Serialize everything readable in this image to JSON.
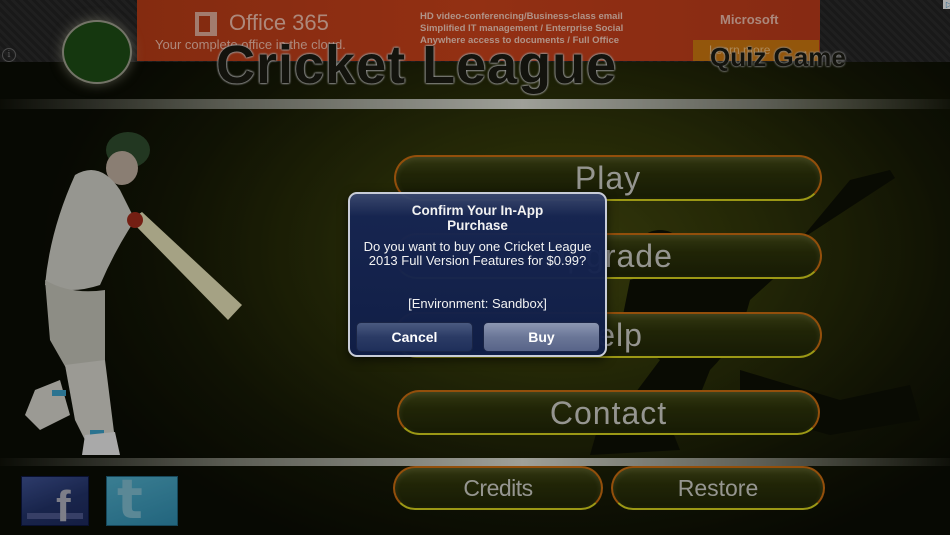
{
  "ad": {
    "brand": "Office 365",
    "tagline": "Your complete office in the cloud.",
    "features": [
      "HD video-conferencing/Business-class email",
      "Simplified IT management / Enterprise Social",
      "Anywhere access to documents / Full Office"
    ],
    "company": "Microsoft",
    "cta_label": "Learn more",
    "cta_arrow": "→",
    "info_glyph": "i",
    "adchoices_glyph": "▷",
    "colors": {
      "banner": "#c4401a",
      "cta": "#c5730f"
    }
  },
  "header": {
    "title": "Cricket League",
    "subtitle": "Quiz Game"
  },
  "menu": {
    "play": "Play",
    "upgrade": "Upgrade",
    "help": "Help",
    "contact": "Contact",
    "credits": "Credits",
    "restore": "Restore"
  },
  "social": {
    "facebook_glyph": "f",
    "twitter_glyph": "t"
  },
  "dialog": {
    "title": "Confirm Your In-App Purchase",
    "message": "Do you want to buy one Cricket League 2013 Full Version Features for $0.99?",
    "environment": "[Environment: Sandbox]",
    "cancel_label": "Cancel",
    "buy_label": "Buy"
  },
  "theme": {
    "button_border": "#c56a0f",
    "button_underline": "#cfcb1d",
    "dialog_bg": "#162552"
  }
}
